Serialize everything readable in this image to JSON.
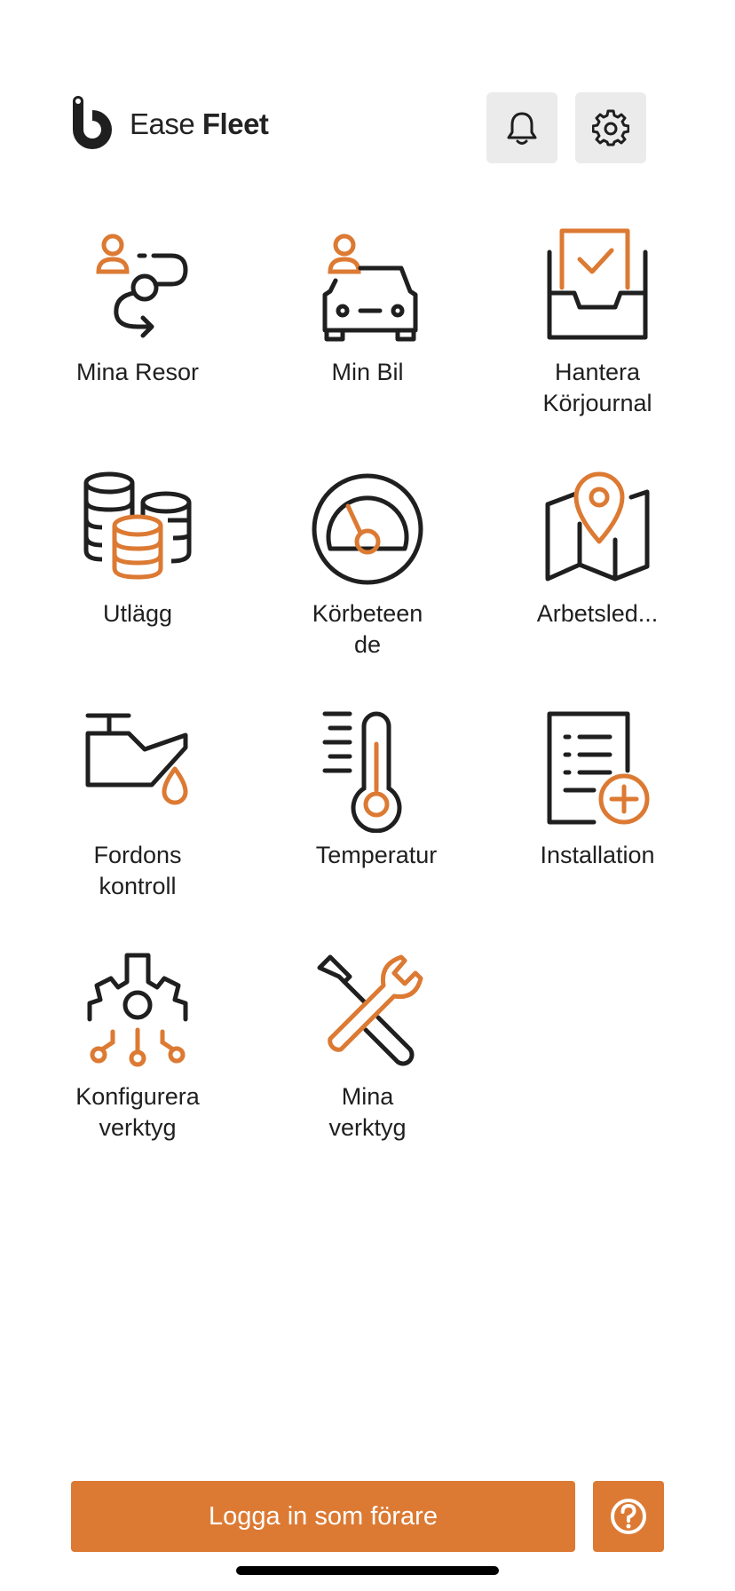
{
  "header": {
    "logo_text_light": "Ease",
    "logo_text_bold": "Fleet",
    "notifications_icon": "bell-icon",
    "settings_icon": "gear-icon"
  },
  "colors": {
    "accent": "#dc7a33",
    "icon_dark": "#1f1f1f",
    "header_button_bg": "#ebebeb"
  },
  "menu": {
    "items": [
      {
        "label": "Mina Resor",
        "icon": "trips-icon"
      },
      {
        "label": "Min Bil",
        "icon": "car-icon"
      },
      {
        "label": "Hantera\nKörjournal",
        "icon": "logbook-inbox-icon"
      },
      {
        "label": "Utlägg",
        "icon": "coins-icon"
      },
      {
        "label": "Körbeteen\nde",
        "icon": "speedometer-icon"
      },
      {
        "label": "Arbetsled...",
        "icon": "map-pin-icon"
      },
      {
        "label": "Fordons\nkontroll",
        "icon": "oil-can-icon"
      },
      {
        "label": "Temperatur",
        "icon": "thermometer-icon"
      },
      {
        "label": "Installation",
        "icon": "document-add-icon"
      },
      {
        "label": "Konfigurera\nverktyg",
        "icon": "gear-network-icon"
      },
      {
        "label": "Mina\nverktyg",
        "icon": "tools-icon"
      }
    ]
  },
  "footer": {
    "login_label": "Logga in som förare",
    "help_icon": "help-circle-icon"
  }
}
